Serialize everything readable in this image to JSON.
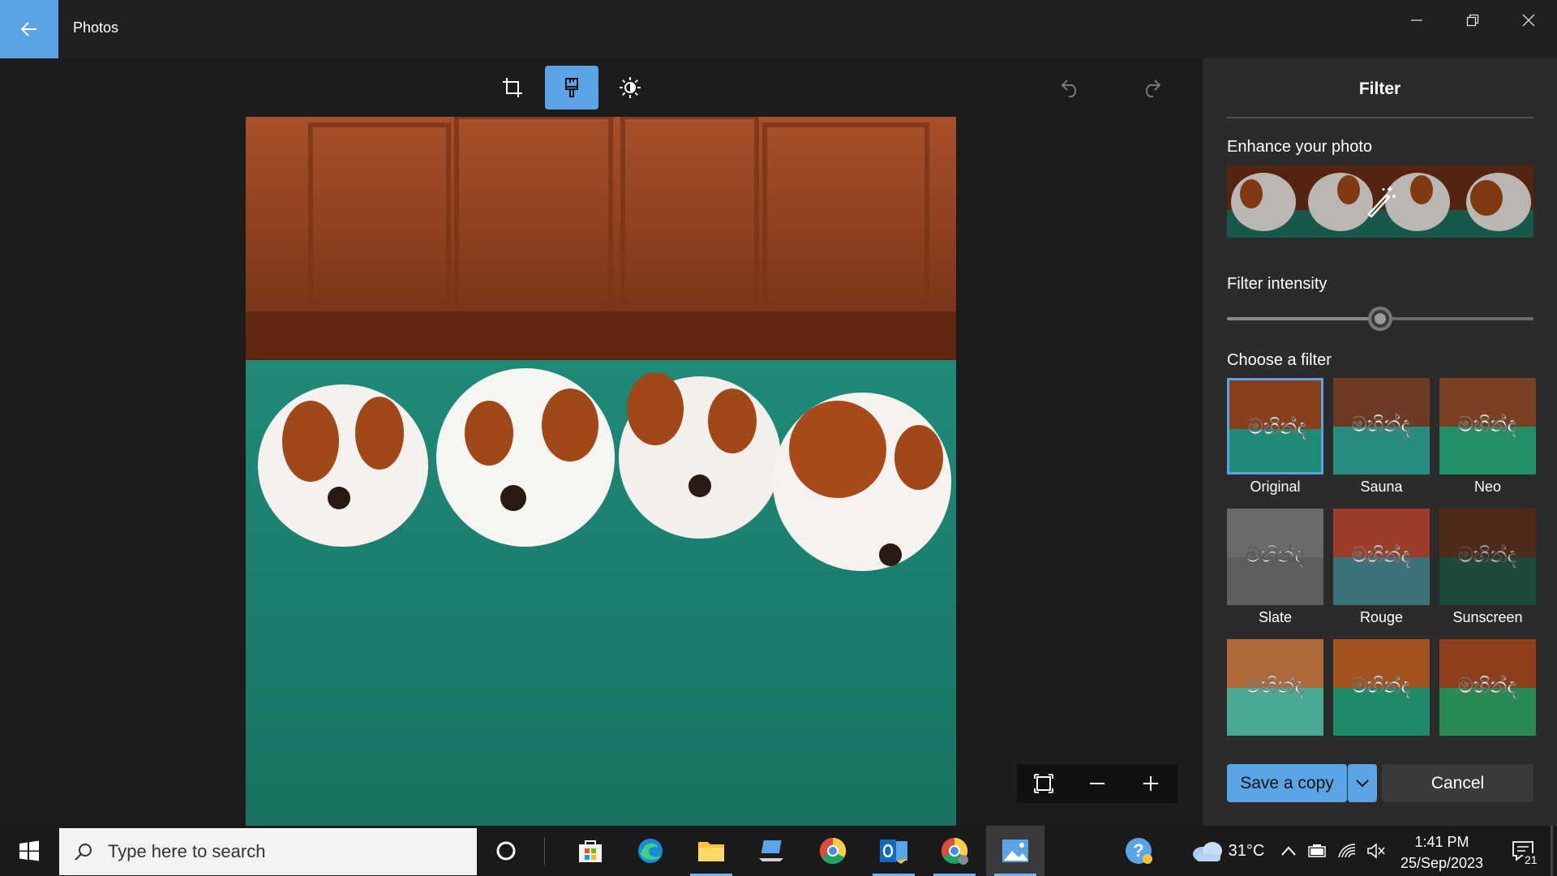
{
  "window": {
    "title": "Photos",
    "accent": "#5aa4e6"
  },
  "toolbar": {
    "tools": [
      "crop-icon",
      "filter-brush-icon",
      "brightness-icon"
    ],
    "active_tool": "filter-brush-icon",
    "history": [
      "undo-icon",
      "redo-icon"
    ]
  },
  "panel": {
    "title": "Filter",
    "enhance_label": "Enhance your photo",
    "intensity_label": "Filter intensity",
    "intensity_value": 0.5,
    "choose_label": "Choose a filter",
    "filters": [
      {
        "name": "Original"
      },
      {
        "name": "Sauna"
      },
      {
        "name": "Neo"
      },
      {
        "name": "Slate"
      },
      {
        "name": "Rouge"
      },
      {
        "name": "Sunscreen"
      },
      {
        "name": ""
      },
      {
        "name": ""
      },
      {
        "name": ""
      }
    ],
    "selected_filter": "Original",
    "thumb_overlay_text": "මහින්ද",
    "save_label": "Save a copy",
    "cancel_label": "Cancel"
  },
  "zoom": {
    "controls": [
      "fit-screen-icon",
      "zoom-out-icon",
      "zoom-in-icon"
    ]
  },
  "taskbar": {
    "search_placeholder": "Type here to search",
    "weather_temp": "31°C",
    "time": "1:41 PM",
    "date": "25/Sep/2023",
    "notification_count": "21"
  }
}
